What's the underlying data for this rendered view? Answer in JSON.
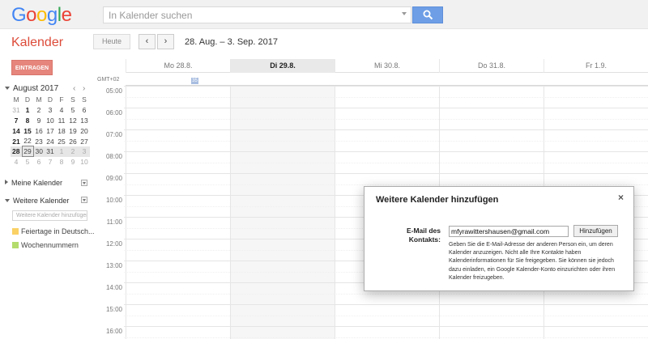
{
  "header": {
    "logo_letters": [
      {
        "ch": "G",
        "color": "#4285f4"
      },
      {
        "ch": "o",
        "color": "#ea4335"
      },
      {
        "ch": "o",
        "color": "#fbbc05"
      },
      {
        "ch": "g",
        "color": "#4285f4"
      },
      {
        "ch": "l",
        "color": "#34a853"
      },
      {
        "ch": "e",
        "color": "#ea4335"
      }
    ],
    "search_placeholder": "In Kalender suchen"
  },
  "toolbar": {
    "app_title": "Kalender",
    "today_label": "Heute",
    "prev_label": "‹",
    "next_label": "›",
    "date_range": "28. Aug. – 3. Sep. 2017"
  },
  "sidebar": {
    "create_label": "EINTRAGEN",
    "mini_month": "August 2017",
    "mini_prev": "‹",
    "mini_next": "›",
    "weekdays": [
      "M",
      "D",
      "M",
      "D",
      "F",
      "S",
      "S"
    ],
    "weeks": [
      [
        "31",
        "1",
        "2",
        "3",
        "4",
        "5",
        "6"
      ],
      [
        "7",
        "8",
        "9",
        "10",
        "11",
        "12",
        "13"
      ],
      [
        "14",
        "15",
        "16",
        "17",
        "18",
        "19",
        "20"
      ],
      [
        "21",
        "22",
        "23",
        "24",
        "25",
        "26",
        "27"
      ],
      [
        "28",
        "29",
        "30",
        "31",
        "1",
        "2",
        "3"
      ],
      [
        "4",
        "5",
        "6",
        "7",
        "8",
        "9",
        "10"
      ]
    ],
    "my_calendars": "Meine Kalender",
    "other_calendars": "Weitere Kalender",
    "add_placeholder": "Weitere Kalender hinzufügen",
    "calendars": [
      {
        "label": "Feiertage in Deutsch...",
        "color": "#fad165"
      },
      {
        "label": "Wochennummern",
        "color": "#b3dc6c"
      }
    ]
  },
  "grid": {
    "timezone": "GMT+02",
    "days": [
      "Mo 28.8.",
      "Di 29.8.",
      "Mi 30.8.",
      "Do 31.8.",
      "Fr 1.9."
    ],
    "allday_badge": "35",
    "hours": [
      "05:00",
      "06:00",
      "07:00",
      "08:00",
      "09:00",
      "10:00",
      "11:00",
      "12:00",
      "13:00",
      "14:00",
      "15:00",
      "16:00"
    ]
  },
  "dialog": {
    "title": "Weitere Kalender hinzufügen",
    "close": "×",
    "email_label": "E-Mail des Kontakts:",
    "email_value": "mfyrawittershausen@gmail.com",
    "add_button": "Hinzufügen",
    "help_text": "Geben Sie die E-Mail-Adresse der anderen Person ein, um deren Kalender anzuzeigen. Nicht alle Ihre Kontakte haben Kalenderinformationen für Sie freigegeben. Sie können sie jedoch dazu einladen, ein Google Kalender-Konto einzurichten oder ihren Kalender freizugeben."
  }
}
